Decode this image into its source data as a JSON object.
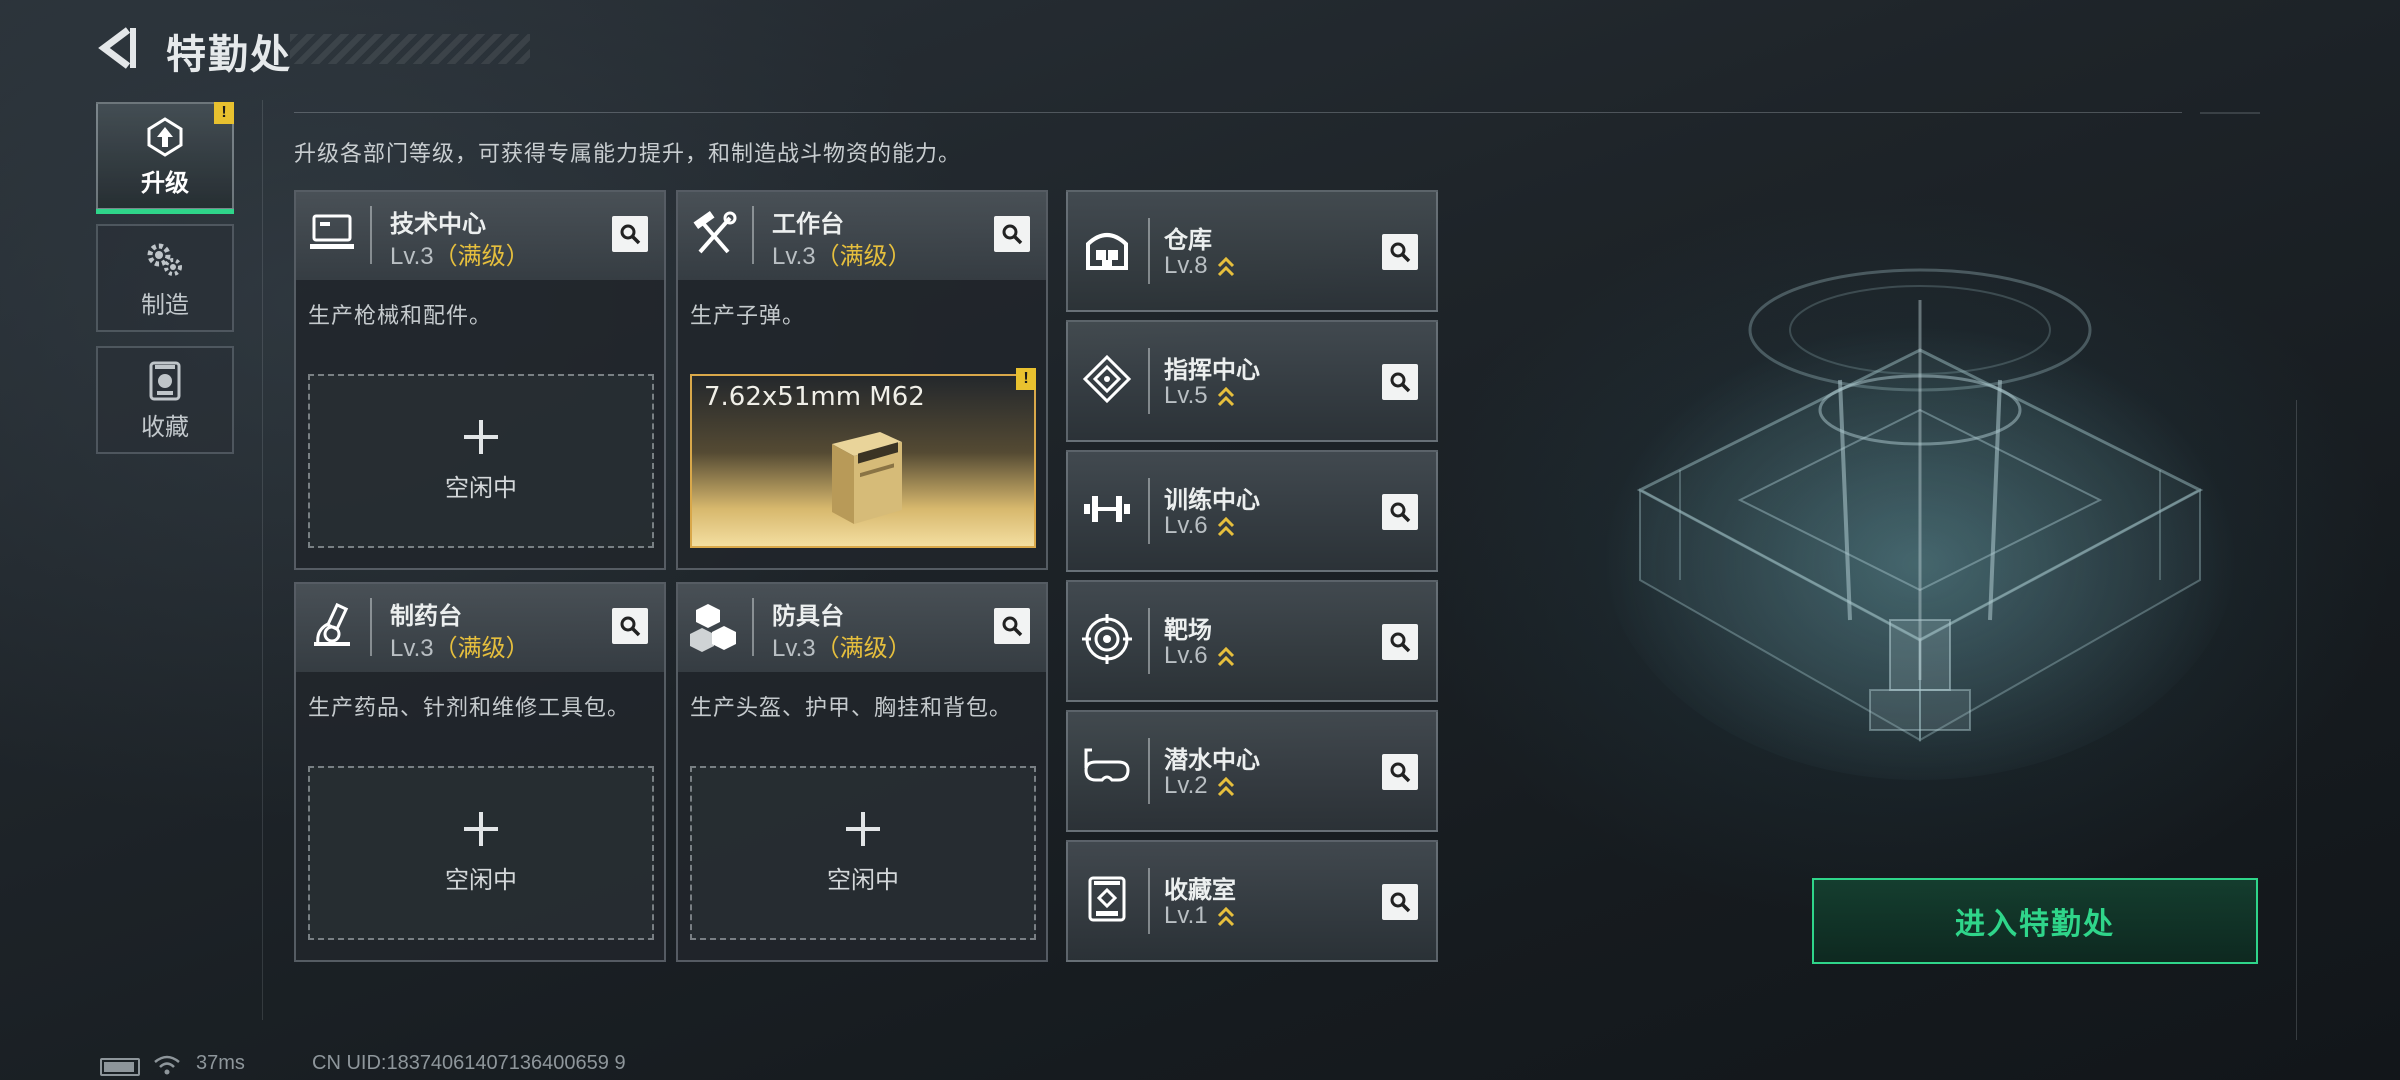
{
  "header": {
    "title": "特勤处"
  },
  "nav": [
    {
      "label": "升级",
      "icon": "upgrade-icon",
      "active": true,
      "badge": "!"
    },
    {
      "label": "制造",
      "icon": "craft-gear-icon",
      "active": false
    },
    {
      "label": "收藏",
      "icon": "collection-icon",
      "active": false
    }
  ],
  "description": "升级各部门等级，可获得专属能力提升，和制造战斗物资的能力。",
  "cards": [
    {
      "name": "技术中心",
      "level": "Lv.3",
      "max": "（满级）",
      "desc": "生产枪械和配件。",
      "slot": "空闲中",
      "icon": "tech-center-icon"
    },
    {
      "name": "工作台",
      "level": "Lv.3",
      "max": "（满级）",
      "desc": "生产子弹。",
      "product": "7.62x51mm M62",
      "badge": "!",
      "icon": "workbench-icon"
    },
    {
      "name": "制药台",
      "level": "Lv.3",
      "max": "（满级）",
      "desc": "生产药品、针剂和维修工具包。",
      "slot": "空闲中",
      "icon": "pharmacy-icon"
    },
    {
      "name": "防具台",
      "level": "Lv.3",
      "max": "（满级）",
      "desc": "生产头盔、护甲、胸挂和背包。",
      "slot": "空闲中",
      "icon": "armor-bench-icon"
    }
  ],
  "facilities": [
    {
      "name": "仓库",
      "level": "Lv.8",
      "icon": "warehouse-icon"
    },
    {
      "name": "指挥中心",
      "level": "Lv.5",
      "icon": "command-center-icon"
    },
    {
      "name": "训练中心",
      "level": "Lv.6",
      "icon": "training-icon"
    },
    {
      "name": "靶场",
      "level": "Lv.6",
      "icon": "target-icon"
    },
    {
      "name": "潜水中心",
      "level": "Lv.2",
      "icon": "diving-mask-icon"
    },
    {
      "name": "收藏室",
      "level": "Lv.1",
      "icon": "collection-room-icon"
    }
  ],
  "enter_button": "进入特勤处",
  "status_bar": {
    "ping": "37ms",
    "uid": "CN UID:18374061407136400659 9"
  },
  "colors": {
    "accent": "#2fd58a",
    "gold": "#e6bf3d",
    "warn": "#e8c12f"
  }
}
